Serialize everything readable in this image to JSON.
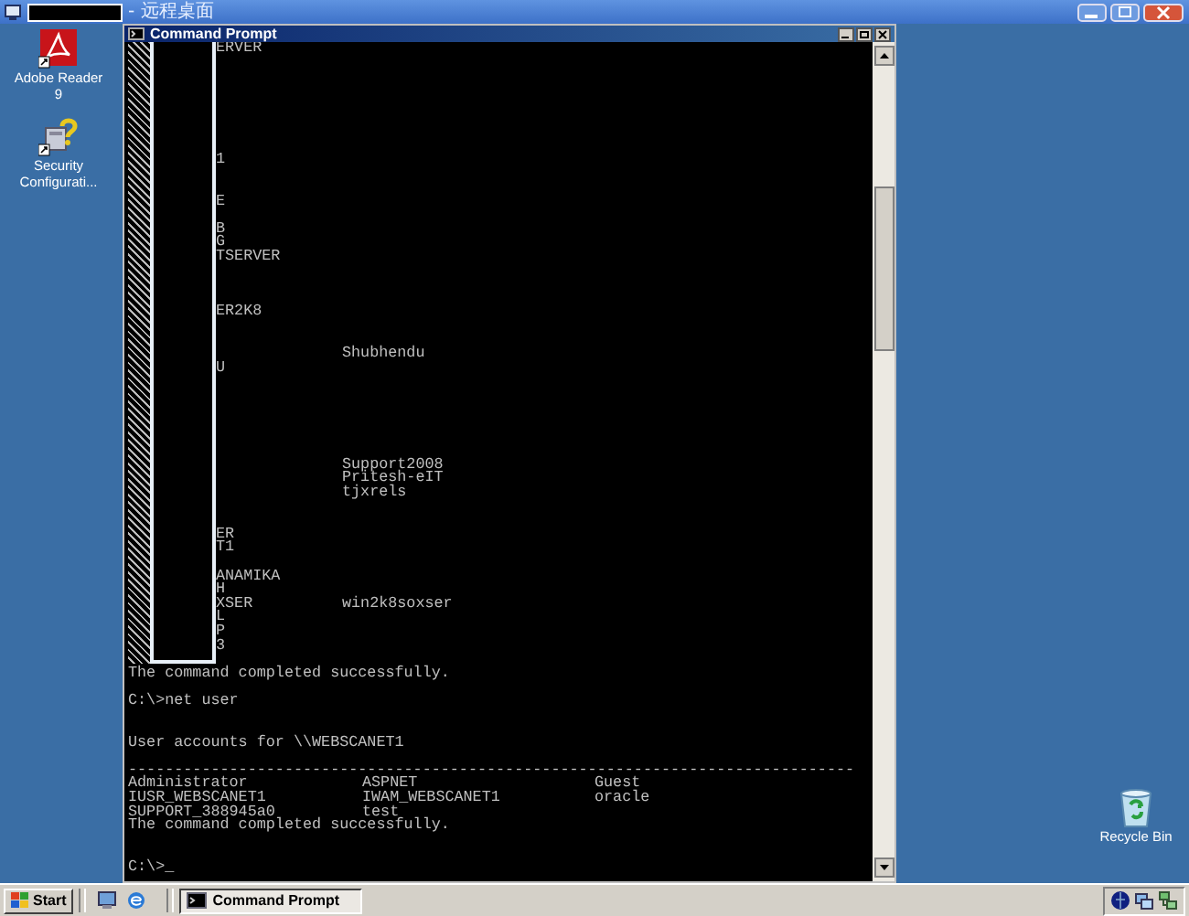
{
  "remote_desktop_bar": {
    "title": "- 远程桌面"
  },
  "desktop_icons": [
    {
      "kind": "pdf",
      "label": "Adobe Reader 9"
    },
    {
      "kind": "security",
      "label": "Security Configurati..."
    }
  ],
  "recycle_bin": {
    "label": "Recycle Bin"
  },
  "console_window": {
    "title": "Command Prompt",
    "lines": [
      {
        "kind": "masked",
        "column_1": "ERVER"
      },
      {
        "kind": "blank"
      },
      {
        "kind": "blank"
      },
      {
        "kind": "blank"
      },
      {
        "kind": "blank"
      },
      {
        "kind": "blank"
      },
      {
        "kind": "blank"
      },
      {
        "kind": "blank"
      },
      {
        "kind": "masked",
        "column_1": "1"
      },
      {
        "kind": "blank"
      },
      {
        "kind": "blank"
      },
      {
        "kind": "masked",
        "column_1": "E"
      },
      {
        "kind": "blank"
      },
      {
        "kind": "masked",
        "column_1": "B"
      },
      {
        "kind": "masked",
        "column_1": "G"
      },
      {
        "kind": "masked",
        "column_1": "TSERVER"
      },
      {
        "kind": "blank"
      },
      {
        "kind": "blank"
      },
      {
        "kind": "blank"
      },
      {
        "kind": "masked",
        "column_1": "ER2K8"
      },
      {
        "kind": "blank"
      },
      {
        "kind": "blank"
      },
      {
        "kind": "masked",
        "column_2": "Shubhendu"
      },
      {
        "kind": "masked",
        "column_1": "U"
      },
      {
        "kind": "blank"
      },
      {
        "kind": "blank"
      },
      {
        "kind": "blank"
      },
      {
        "kind": "blank"
      },
      {
        "kind": "blank"
      },
      {
        "kind": "blank"
      },
      {
        "kind": "masked",
        "column_2": "Support2008"
      },
      {
        "kind": "masked",
        "column_2": "Pritesh-eIT"
      },
      {
        "kind": "masked",
        "column_2": "tjxrels"
      },
      {
        "kind": "blank"
      },
      {
        "kind": "blank"
      },
      {
        "kind": "masked",
        "column_1": "ER"
      },
      {
        "kind": "masked",
        "column_1": "T1"
      },
      {
        "kind": "blank"
      },
      {
        "kind": "masked",
        "column_1": "ANAMIKA"
      },
      {
        "kind": "masked",
        "column_1": "H"
      },
      {
        "kind": "masked",
        "column_1": "XSER",
        "column_2": "win2k8soxser"
      },
      {
        "kind": "masked",
        "column_1": "L"
      },
      {
        "kind": "masked",
        "column_1": "P"
      },
      {
        "kind": "masked",
        "column_1": "3"
      },
      {
        "kind": "blank"
      },
      {
        "kind": "text",
        "column_1": "The command completed successfully."
      },
      {
        "kind": "blank"
      },
      {
        "kind": "text",
        "column_1": "C:\\>net user"
      },
      {
        "kind": "blank"
      },
      {
        "kind": "blank"
      },
      {
        "kind": "text",
        "column_1": "User accounts for \\\\WEBSCANET1"
      },
      {
        "kind": "blank"
      },
      {
        "kind": "text",
        "column_1": "-------------------------------------------------------------------------------"
      },
      {
        "kind": "table",
        "column_1": "Administrator",
        "column_2": "ASPNET",
        "column_3": "Guest"
      },
      {
        "kind": "table",
        "column_1": "IUSR_WEBSCANET1",
        "column_2": "IWAM_WEBSCANET1",
        "column_3": "oracle"
      },
      {
        "kind": "table",
        "column_1": "SUPPORT_388945a0",
        "column_2": "test"
      },
      {
        "kind": "text",
        "column_1": "The command completed successfully."
      },
      {
        "kind": "blank"
      },
      {
        "kind": "blank"
      },
      {
        "kind": "text",
        "column_1": "C:\\>_"
      }
    ]
  },
  "taskbar": {
    "start": "Start",
    "tasks": [
      {
        "label": "Command Prompt",
        "selected": true
      }
    ]
  }
}
